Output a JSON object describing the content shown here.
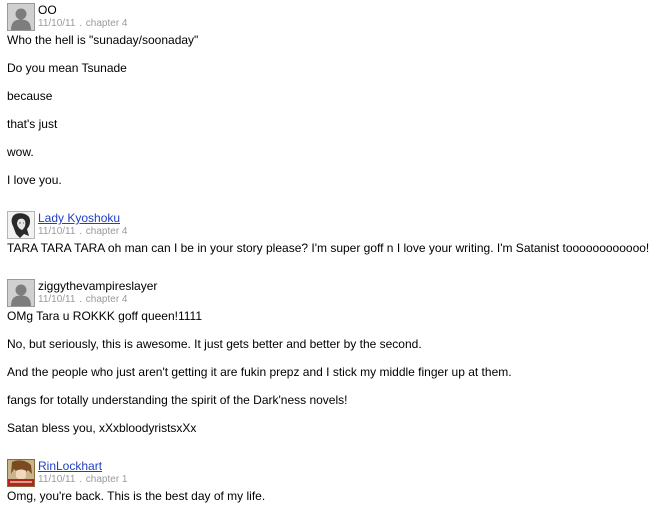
{
  "reviews": [
    {
      "author": "OO",
      "author_is_link": false,
      "avatar": "default-avatar-silhouette-icon",
      "date": "11/10/11",
      "chapter": "chapter 4",
      "paragraphs": [
        "Who the hell is \"sunaday/soonaday\"",
        "Do you mean Tsunade",
        "because",
        "that's just",
        "wow.",
        "I love you."
      ]
    },
    {
      "author": "Lady Kyoshoku",
      "author_is_link": true,
      "avatar": "sketch-portrait-avatar",
      "date": "11/10/11",
      "chapter": "chapter 4",
      "paragraphs": [
        "TARA TARA TARA oh man can I be in your story please? I'm super goff n I love your writing. I'm Satanist toooooooooooo!"
      ]
    },
    {
      "author": "ziggythevampireslayer",
      "author_is_link": false,
      "avatar": "default-avatar-silhouette-icon",
      "date": "11/10/11",
      "chapter": "chapter 4",
      "paragraphs": [
        "OMg Tara u ROKKK goff queen!1111",
        "No, but seriously, this is awesome. It just gets better and better by the second.",
        "And the people who just aren't getting it are fukin prepz and I stick my middle finger up at them.",
        "fangs for totally understanding the spirit of the Dark'ness novels!",
        "Satan bless you, xXxbloodyristsxXx"
      ]
    },
    {
      "author": "RinLockhart",
      "author_is_link": true,
      "avatar": "anime-character-avatar",
      "date": "11/10/11",
      "chapter": "chapter 1",
      "paragraphs": [
        "Omg, you're back. This is the best day of my life."
      ]
    }
  ],
  "meta_separator": ".",
  "colors": {
    "link": "#1e3fc4",
    "meta": "#9a9a9a",
    "text": "#000000",
    "background": "#ffffff"
  }
}
